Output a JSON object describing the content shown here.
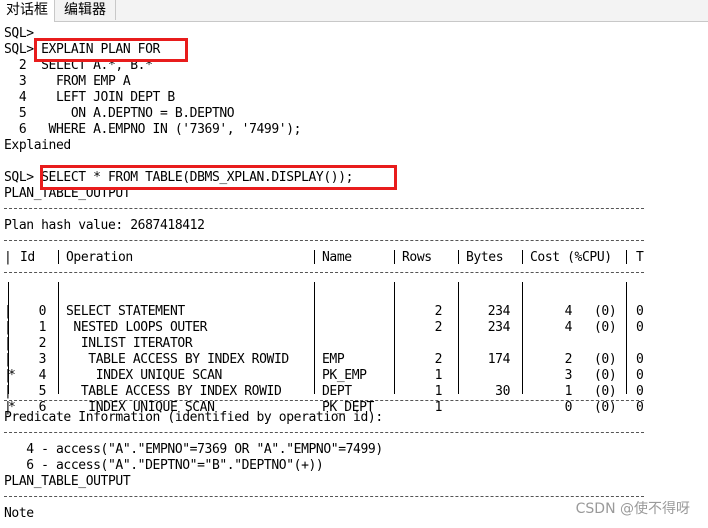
{
  "tabs": [
    "对话框",
    "编辑器"
  ],
  "lines": {
    "l1": "SQL>",
    "l2": "SQL> EXPLAIN PLAN FOR",
    "l3": "  2  SELECT A.*, B.*",
    "l4": "  3    FROM EMP A",
    "l5": "  4    LEFT JOIN DEPT B",
    "l6": "  5      ON A.DEPTNO = B.DEPTNO",
    "l7": "  6   WHERE A.EMPNO IN ('7369', '7499');",
    "l8": "Explained",
    "l9": "SQL> SELECT * FROM TABLE(DBMS_XPLAN.DISPLAY());",
    "l10": "PLAN_TABLE_OUTPUT",
    "l11": "Plan hash value: 2687418412",
    "l12": "Predicate Information (identified by operation id):",
    "l13": "   4 - access(\"A\".\"EMPNO\"=7369 OR \"A\".\"EMPNO\"=7499)",
    "l14": "   6 - access(\"A\".\"DEPTNO\"=\"B\".\"DEPTNO\"(+))",
    "l15": "PLAN_TABLE_OUTPUT",
    "l16": "Note"
  },
  "plan_table": {
    "headers": [
      "Id",
      "Operation",
      "Name",
      "Rows",
      "Bytes",
      "Cost (%CPU)",
      "T"
    ],
    "rows": [
      {
        "star": "",
        "id": "0",
        "op": "SELECT STATEMENT",
        "name": "",
        "rows": "2",
        "bytes": "234",
        "cost": "4",
        "cpu": "(0)",
        "t": "0"
      },
      {
        "star": "",
        "id": "1",
        "op": " NESTED LOOPS OUTER",
        "name": "",
        "rows": "2",
        "bytes": "234",
        "cost": "4",
        "cpu": "(0)",
        "t": "0"
      },
      {
        "star": "",
        "id": "2",
        "op": "  INLIST ITERATOR",
        "name": "",
        "rows": "",
        "bytes": "",
        "cost": "",
        "cpu": "",
        "t": ""
      },
      {
        "star": "",
        "id": "3",
        "op": "   TABLE ACCESS BY INDEX ROWID",
        "name": "EMP",
        "rows": "2",
        "bytes": "174",
        "cost": "2",
        "cpu": "(0)",
        "t": "0"
      },
      {
        "star": "*",
        "id": "4",
        "op": "    INDEX UNIQUE SCAN",
        "name": "PK_EMP",
        "rows": "1",
        "bytes": "",
        "cost": "3",
        "cpu": "(0)",
        "t": "0"
      },
      {
        "star": "",
        "id": "5",
        "op": "  TABLE ACCESS BY INDEX ROWID",
        "name": "DEPT",
        "rows": "1",
        "bytes": "30",
        "cost": "1",
        "cpu": "(0)",
        "t": "0"
      },
      {
        "star": "*",
        "id": "6",
        "op": "   INDEX UNIQUE SCAN",
        "name": "PK_DEPT",
        "rows": "1",
        "bytes": "",
        "cost": "0",
        "cpu": "(0)",
        "t": "0"
      }
    ]
  },
  "watermark": "CSDN @使不得呀",
  "colors": {
    "highlight": "#e81c1c",
    "text": "#000000",
    "tab_bg": "#f3f3f3"
  }
}
